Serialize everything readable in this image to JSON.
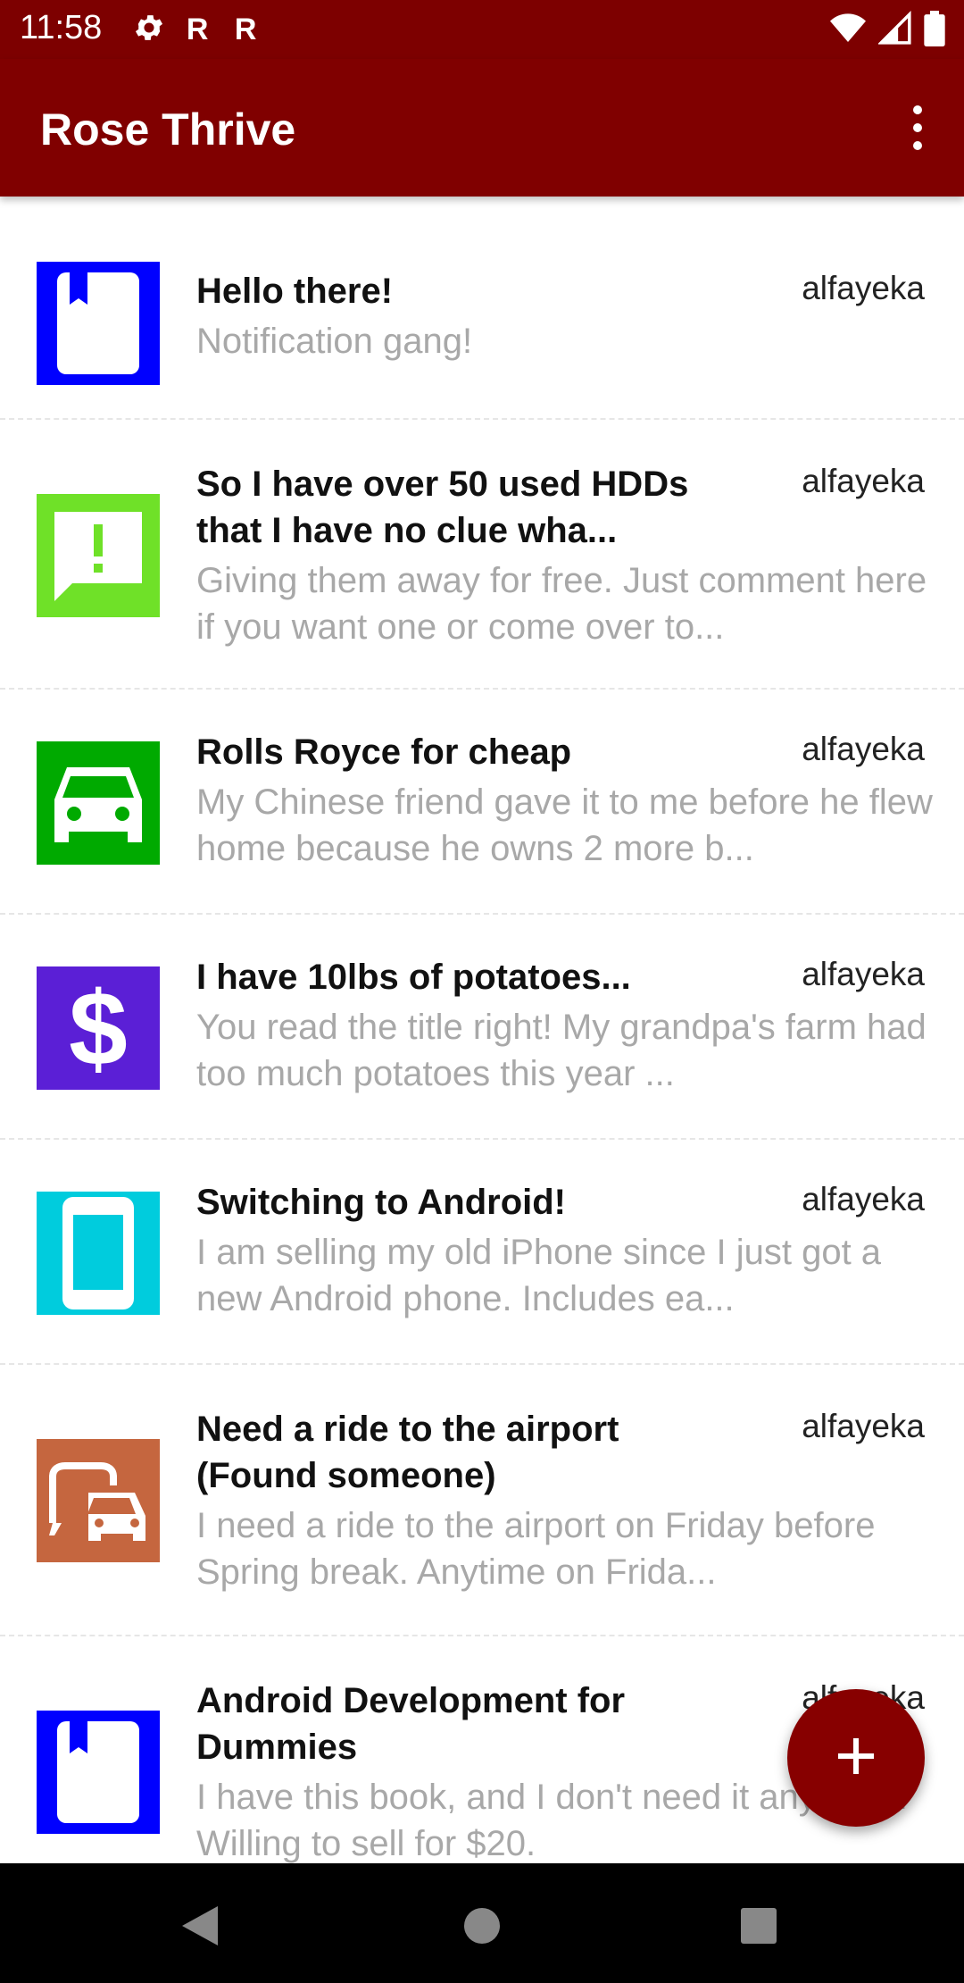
{
  "status_bar": {
    "time": "11:58",
    "left_icons": [
      "gear-icon",
      "r-app-icon",
      "r-app-icon"
    ],
    "right_icons": [
      "wifi-icon",
      "signal-icon",
      "battery-icon"
    ]
  },
  "app_bar": {
    "title": "Rose Thrive",
    "menu_icon": "more-vert-icon"
  },
  "colors": {
    "primary": "#800000",
    "status_bar": "#7d0000",
    "fab": "#870000",
    "title_text": "#111111",
    "body_text": "#a8a8a8"
  },
  "posts": [
    {
      "title": "Hello there!",
      "author": "alfayeka",
      "body": "Notification gang!",
      "icon": "book-icon",
      "icon_color": "#0000ff"
    },
    {
      "title": "So I have over 50 used HDDs that I have no clue wha...",
      "author": "alfayeka",
      "body": "Giving them away for free. Just comment here if you want one or come over to...",
      "icon": "feedback-icon",
      "icon_color": "#6fe128"
    },
    {
      "title": "Rolls Royce for cheap",
      "author": "alfayeka",
      "body": "My Chinese friend gave it to me before he flew home because he owns 2 more b...",
      "icon": "car-icon",
      "icon_color": "#00aa00"
    },
    {
      "title": "I have 10lbs of potatoes...",
      "author": "alfayeka",
      "body": "You read the title right! My grandpa's farm had too much potatoes this year ...",
      "icon": "dollar-icon",
      "icon_color": "#5b1fd6"
    },
    {
      "title": "Switching to Android!",
      "author": "alfayeka",
      "body": "I am selling my old iPhone since I just got a new Android phone. Includes ea...",
      "icon": "phone-icon",
      "icon_color": "#00ccdd"
    },
    {
      "title": "Need a ride to the airport (Found someone)",
      "author": "alfayeka",
      "body": "I need a ride to the airport on Friday before Spring break. Anytime on Frida...",
      "icon": "commute-icon",
      "icon_color": "#c5663f"
    },
    {
      "title": "Android Development for Dummies",
      "author": "alfayeka",
      "body": "I have this book, and I don't need it anymore. Willing to sell for $20.",
      "icon": "book-icon",
      "icon_color": "#0000ff"
    }
  ],
  "fab": {
    "icon": "add-icon"
  },
  "nav_bar": {
    "icons": [
      "back-icon",
      "home-icon",
      "recents-icon"
    ]
  }
}
